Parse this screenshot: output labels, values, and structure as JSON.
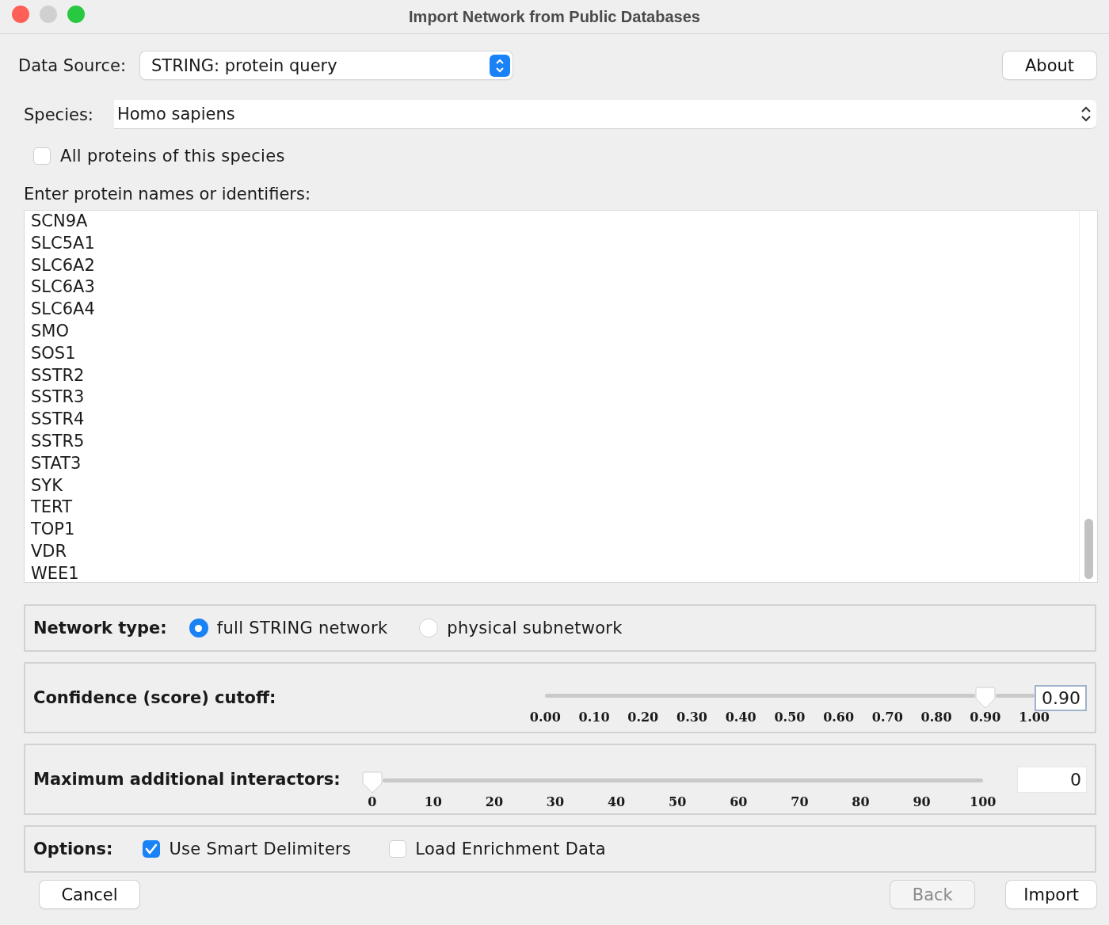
{
  "window": {
    "title": "Import Network from Public Databases"
  },
  "data_source": {
    "label": "Data Source:",
    "value": "STRING: protein query"
  },
  "about_button": "About",
  "species": {
    "label": "Species:",
    "value": "Homo sapiens"
  },
  "all_proteins": {
    "label": "All proteins of this species",
    "checked": false
  },
  "proteins": {
    "label": "Enter protein names or identifiers:",
    "lines": [
      "SCN9A",
      "SLC5A1",
      "SLC6A2",
      "SLC6A3",
      "SLC6A4",
      "SMO",
      "SOS1",
      "SSTR2",
      "SSTR3",
      "SSTR4",
      "SSTR5",
      "STAT3",
      "SYK",
      "TERT",
      "TOP1",
      "VDR",
      "WEE1"
    ]
  },
  "network_type": {
    "label": "Network type:",
    "options": [
      {
        "label": "full STRING network",
        "selected": true
      },
      {
        "label": "physical subnetwork",
        "selected": false
      }
    ]
  },
  "sliders": [
    {
      "label": "Confidence (score) cutoff:",
      "level": 0.9,
      "ticks": [
        "0.00",
        "0.10",
        "0.20",
        "0.30",
        "0.40",
        "0.50",
        "0.60",
        "0.70",
        "0.80",
        "0.90",
        "1.00"
      ],
      "value": "0.90",
      "focused": true
    },
    {
      "label": "Maximum additional interactors:",
      "level": 0,
      "ticks": [
        "0",
        "10",
        "20",
        "30",
        "40",
        "50",
        "60",
        "70",
        "80",
        "90",
        "100"
      ],
      "value": "0",
      "focused": false
    }
  ],
  "options": {
    "label": "Options:",
    "items": [
      {
        "label": "Use Smart Delimiters",
        "checked": true
      },
      {
        "label": "Load Enrichment Data",
        "checked": false
      }
    ]
  },
  "buttons": [
    {
      "label": "Cancel",
      "disabled": false
    },
    {
      "label": "Back",
      "disabled": true
    },
    {
      "label": "Import",
      "disabled": false
    }
  ]
}
